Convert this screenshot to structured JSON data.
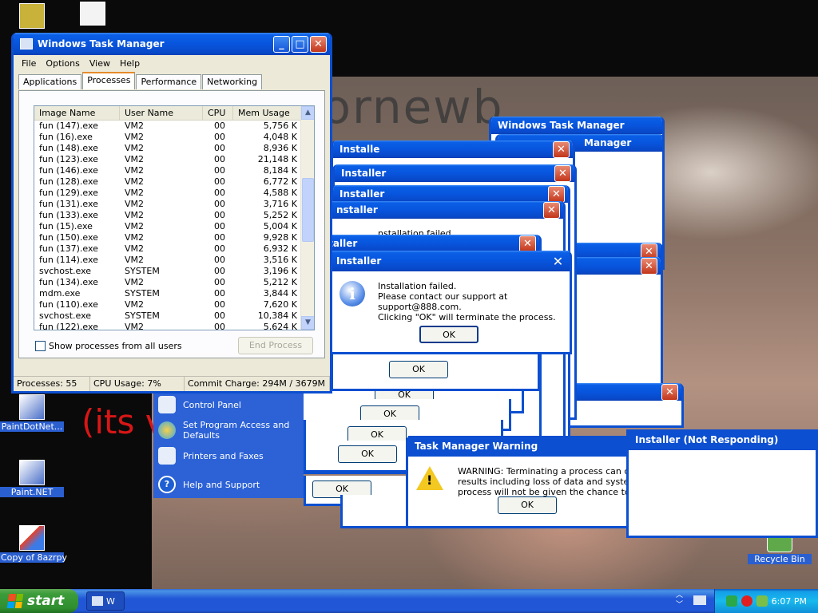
{
  "wallpaper": {
    "big_text": "utornewb",
    "red_text": "(its v"
  },
  "desktop_icons": [
    {
      "label": "PaintDotNet..."
    },
    {
      "label": "Paint.NET"
    },
    {
      "label": "Copy of 8azrpy"
    },
    {
      "label": "Recycle Bin"
    }
  ],
  "taskmgr": {
    "title": "Windows Task Manager",
    "menu": [
      "File",
      "Options",
      "View",
      "Help"
    ],
    "tabs": [
      "Applications",
      "Processes",
      "Performance",
      "Networking"
    ],
    "columns": [
      "Image Name",
      "User Name",
      "CPU",
      "Mem Usage"
    ],
    "rows": [
      [
        "fun (147).exe",
        "VM2",
        "00",
        "5,756 K"
      ],
      [
        "fun (16).exe",
        "VM2",
        "00",
        "4,048 K"
      ],
      [
        "fun (148).exe",
        "VM2",
        "00",
        "8,936 K"
      ],
      [
        "fun (123).exe",
        "VM2",
        "00",
        "21,148 K"
      ],
      [
        "fun (146).exe",
        "VM2",
        "00",
        "8,184 K"
      ],
      [
        "fun (128).exe",
        "VM2",
        "00",
        "6,772 K"
      ],
      [
        "fun (129).exe",
        "VM2",
        "00",
        "4,588 K"
      ],
      [
        "fun (131).exe",
        "VM2",
        "00",
        "3,716 K"
      ],
      [
        "fun (133).exe",
        "VM2",
        "00",
        "5,252 K"
      ],
      [
        "fun (15).exe",
        "VM2",
        "00",
        "5,004 K"
      ],
      [
        "fun (150).exe",
        "VM2",
        "00",
        "9,928 K"
      ],
      [
        "fun (137).exe",
        "VM2",
        "00",
        "6,932 K"
      ],
      [
        "fun (114).exe",
        "VM2",
        "00",
        "3,516 K"
      ],
      [
        "svchost.exe",
        "SYSTEM",
        "00",
        "3,196 K"
      ],
      [
        "fun (134).exe",
        "VM2",
        "00",
        "5,212 K"
      ],
      [
        "mdm.exe",
        "SYSTEM",
        "00",
        "3,844 K"
      ],
      [
        "fun (110).exe",
        "VM2",
        "00",
        "7,620 K"
      ],
      [
        "svchost.exe",
        "SYSTEM",
        "00",
        "10,384 K"
      ],
      [
        "fun (122).exe",
        "VM2",
        "00",
        "5,624 K"
      ]
    ],
    "show_all_label": "Show processes from all users",
    "end_process_label": "End Process",
    "status": {
      "processes": "Processes: 55",
      "cpu": "CPU Usage: 7%",
      "commit": "Commit Charge: 294M / 3679M"
    }
  },
  "start_menu": {
    "items": [
      "Control Panel",
      "Set Program Access and Defaults",
      "Printers and Faxes",
      "Help and Support"
    ]
  },
  "installer": {
    "title": "Installer",
    "line1": "Installation failed.",
    "line2": "Please contact our support at support@888.com.",
    "line3": "Clicking \"OK\" will terminate the process.",
    "ok": "OK"
  },
  "stacked_windows": {
    "installer_title": "Installer",
    "installer_partial": "Installe",
    "installer_partial2": "nstaller",
    "taskmgr_title": "Windows Task Manager",
    "taskmgr_partial": "Manager",
    "installation_partial": "nstallation failed",
    "ok": "OK"
  },
  "warning": {
    "title": "Task Manager Warning",
    "line1": "WARNING: Terminating a process can cause",
    "line2": "results including loss of data and system insta",
    "line3": "process will not be given the chance to save",
    "ok": "OK"
  },
  "not_responding": {
    "title": "Installer (Not Responding)"
  },
  "taskbar": {
    "start": "start",
    "task_label": "W",
    "clock": "6:07 PM"
  }
}
